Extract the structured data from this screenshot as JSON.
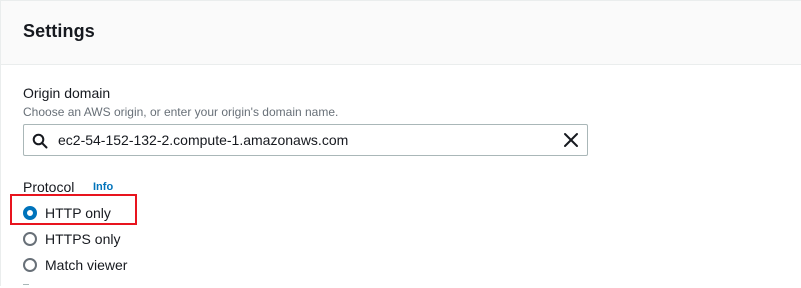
{
  "panel": {
    "title": "Settings"
  },
  "origin_domain": {
    "label": "Origin domain",
    "description": "Choose an AWS origin, or enter your origin's domain name.",
    "value": "ec2-54-152-132-2.compute-1.amazonaws.com",
    "icons": [
      "search-icon",
      "clear-icon"
    ]
  },
  "protocol": {
    "label": "Protocol",
    "info_link": "Info",
    "selected": "HTTP only",
    "options": [
      {
        "label": "HTTP only",
        "checked": true
      },
      {
        "label": "HTTPS only",
        "checked": false
      },
      {
        "label": "Match viewer",
        "checked": false
      }
    ]
  },
  "colors": {
    "accent": "#0073bb",
    "highlight": "#e8141e",
    "text": "#16191f",
    "muted": "#687078"
  }
}
